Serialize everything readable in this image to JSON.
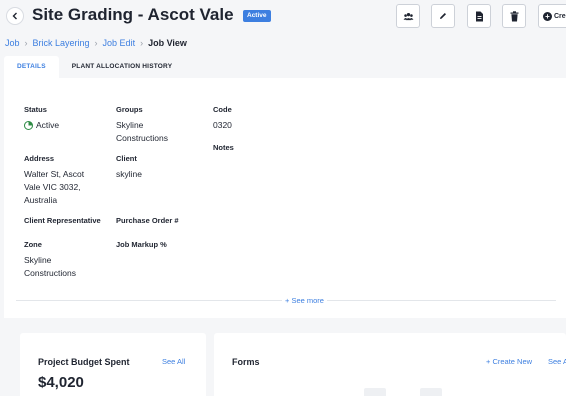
{
  "header": {
    "title": "Site Grading - Ascot Vale",
    "status_badge": "Active",
    "actions": [
      {
        "name": "team-icon"
      },
      {
        "name": "edit-icon"
      },
      {
        "name": "document-icon"
      },
      {
        "name": "trash-icon"
      }
    ],
    "create_label": "Cre"
  },
  "breadcrumb": {
    "items": [
      "Job",
      "Brick Layering",
      "Job Edit"
    ],
    "current": "Job View"
  },
  "tabs": [
    {
      "label": "DETAILS",
      "active": true
    },
    {
      "label": "PLANT ALLOCATION HISTORY",
      "active": false
    }
  ],
  "details": {
    "status_label": "Status",
    "status_value": "Active",
    "groups_label": "Groups",
    "groups_value": "Skyline Constructions",
    "code_label": "Code",
    "code_value": "0320",
    "notes_label": "Notes",
    "address_label": "Address",
    "address_value": "Walter St, Ascot Vale VIC 3032, Australia",
    "client_label": "Client",
    "client_value": "skyline",
    "client_rep_label": "Client Representative",
    "po_label": "Purchase Order #",
    "zone_label": "Zone",
    "zone_value": "Skyline Constructions",
    "markup_label": "Job Markup %",
    "see_more": "+ See more"
  },
  "budget": {
    "title": "Project Budget Spent",
    "see_all": "See All",
    "amount": "$4,020"
  },
  "forms": {
    "title": "Forms",
    "create_new": "+ Create New",
    "see_all": "See A"
  },
  "colors": {
    "accent": "#3d7fe0",
    "status_green": "#2e8b45",
    "background": "#f5f6f8"
  }
}
